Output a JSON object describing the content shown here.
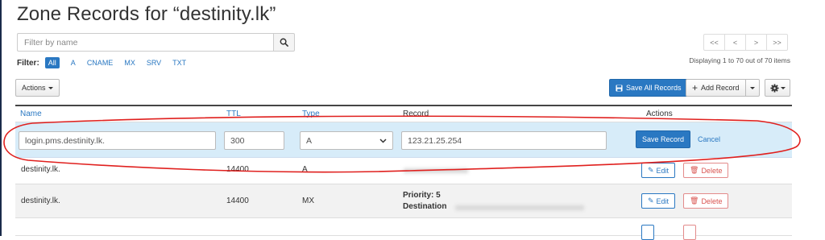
{
  "title": "Zone Records for “destinity.lk”",
  "filter": {
    "placeholder": "Filter by name",
    "label": "Filter:",
    "types": [
      "All",
      "A",
      "CNAME",
      "MX",
      "SRV",
      "TXT"
    ]
  },
  "pagination": {
    "buttons": [
      "<<",
      "<",
      ">",
      ">>"
    ],
    "summary": "Displaying 1 to 70 out of 70 items"
  },
  "toolbar": {
    "actions_label": "Actions",
    "save_all_label": "Save All Records",
    "add_record_label": "Add Record"
  },
  "table": {
    "headers": {
      "name": "Name",
      "ttl": "TTL",
      "type": "Type",
      "record": "Record",
      "actions": "Actions"
    },
    "edit_row": {
      "name": "login.pms.destinity.lk.",
      "ttl": "300",
      "type": "A",
      "record": "123.21.25.254",
      "save_label": "Save Record",
      "cancel_label": "Cancel"
    },
    "rows": [
      {
        "name": "destinity.lk.",
        "ttl": "14400",
        "type": "A"
      },
      {
        "name": "destinity.lk.",
        "ttl": "14400",
        "type": "MX",
        "priority": "Priority: 5",
        "destination_label": "Destination"
      }
    ],
    "edit_label": "Edit",
    "delete_label": "Delete"
  },
  "colors": {
    "accent": "#2a78c2",
    "edit_row_bg": "#d7ecf9",
    "annotation": "#e0201e",
    "delete": "#d9534f"
  },
  "icons": [
    "search-icon",
    "save-icon",
    "plus-icon",
    "gear-icon",
    "pencil-icon",
    "trash-icon",
    "chevron-down-icon"
  ]
}
